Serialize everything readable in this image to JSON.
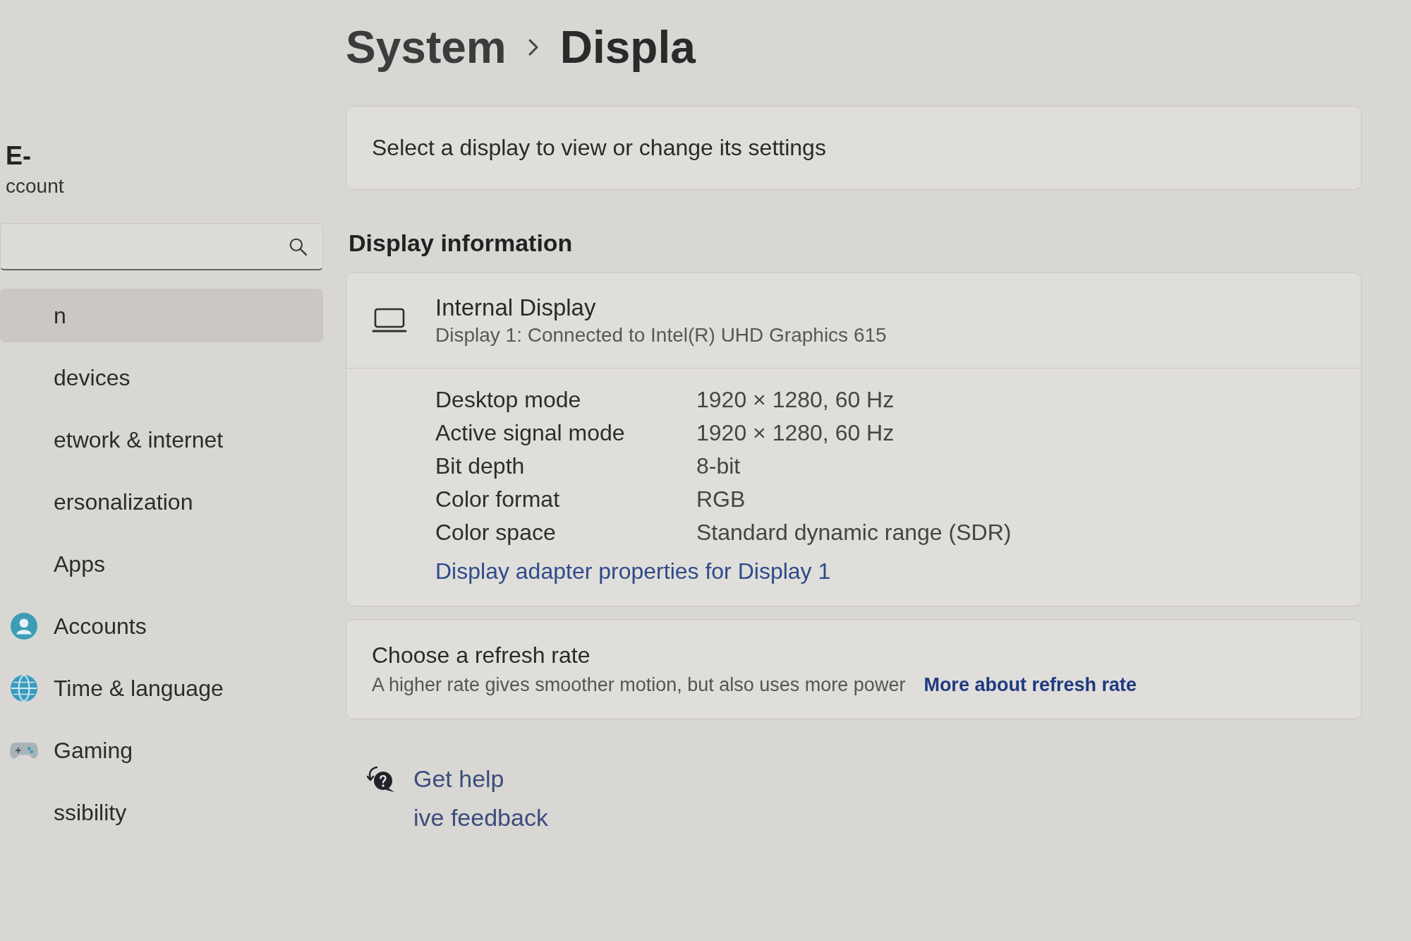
{
  "sidebar": {
    "user": {
      "name": "E-",
      "account": "ccount"
    },
    "items": [
      {
        "label": "n",
        "kind": "text",
        "selected": true
      },
      {
        "label": "devices",
        "kind": "text",
        "selected": false
      },
      {
        "label": "etwork & internet",
        "kind": "text",
        "selected": false
      },
      {
        "label": "ersonalization",
        "kind": "text",
        "selected": false
      },
      {
        "label": "Apps",
        "kind": "text",
        "selected": false
      },
      {
        "label": "Accounts",
        "kind": "icon",
        "selected": false
      },
      {
        "label": "Time & language",
        "kind": "icon",
        "selected": false
      },
      {
        "label": "Gaming",
        "kind": "icon",
        "selected": false
      },
      {
        "label": "ssibility",
        "kind": "text",
        "selected": false
      }
    ]
  },
  "breadcrumb": {
    "parent": "System",
    "current": "Displa"
  },
  "display_select": {
    "text": "Select a display to view or change its settings"
  },
  "display_information": {
    "heading": "Display information",
    "display": {
      "name": "Internal Display",
      "connection": "Display 1: Connected to Intel(R) UHD Graphics 615"
    },
    "properties": [
      {
        "label": "Desktop mode",
        "value": "1920 × 1280, 60 Hz"
      },
      {
        "label": "Active signal mode",
        "value": "1920 × 1280, 60 Hz"
      },
      {
        "label": "Bit depth",
        "value": "8-bit"
      },
      {
        "label": "Color format",
        "value": "RGB"
      },
      {
        "label": "Color space",
        "value": "Standard dynamic range (SDR)"
      }
    ],
    "link": "Display adapter properties for Display 1"
  },
  "refresh_rate": {
    "title": "Choose a refresh rate",
    "description": "A higher rate gives smoother motion, but also uses more power",
    "link": "More about refresh rate"
  },
  "help_links": [
    {
      "label": "Get help",
      "kind": "help"
    },
    {
      "label": "ive feedback",
      "kind": "feedback"
    }
  ]
}
